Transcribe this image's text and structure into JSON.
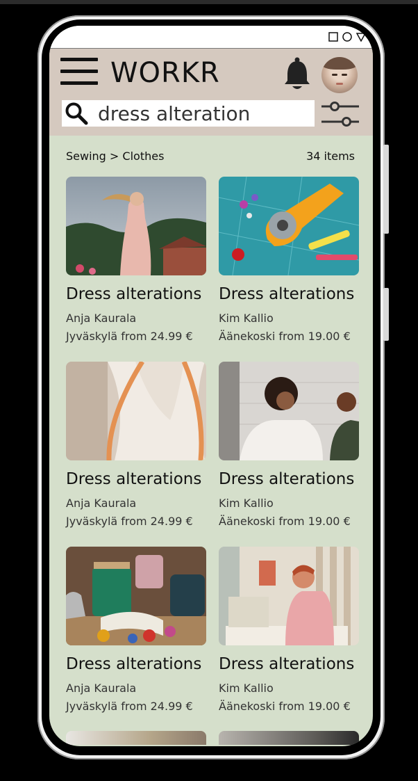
{
  "app": {
    "brand": "WORKR"
  },
  "status_bar": {
    "icons": [
      "square-icon",
      "circle-icon",
      "triangle-icon"
    ]
  },
  "search": {
    "value": "dress alteration"
  },
  "breadcrumb": {
    "category": "Sewing",
    "separator": ">",
    "subcategory": "Clothes"
  },
  "results": {
    "count_label": "34 items",
    "cards": [
      {
        "title": "Dress alterations",
        "seller": "Anja Kaurala",
        "location_price": "Jyväskylä from 24.99 €"
      },
      {
        "title": "Dress alterations",
        "seller": "Kim Kallio",
        "location_price": "Äänekoski from 19.00 €"
      },
      {
        "title": "Dress alterations",
        "seller": "Anja Kaurala",
        "location_price": "Jyväskylä from 24.99 €"
      },
      {
        "title": "Dress alterations",
        "seller": "Kim Kallio",
        "location_price": "Äänekoski from 19.00 €"
      },
      {
        "title": "Dress alterations",
        "seller": "Anja Kaurala",
        "location_price": "Jyväskylä from 24.99 €"
      },
      {
        "title": "Dress alterations",
        "seller": "Kim Kallio",
        "location_price": "Äänekoski from 19.00 €"
      }
    ]
  },
  "colors": {
    "header_bg": "#d5c9bf",
    "content_bg": "#d5dfcb",
    "search_bg": "#ffffff",
    "text": "#111111"
  },
  "icons": [
    "menu-icon",
    "bell-icon",
    "search-icon",
    "filter-sliders-icon"
  ]
}
